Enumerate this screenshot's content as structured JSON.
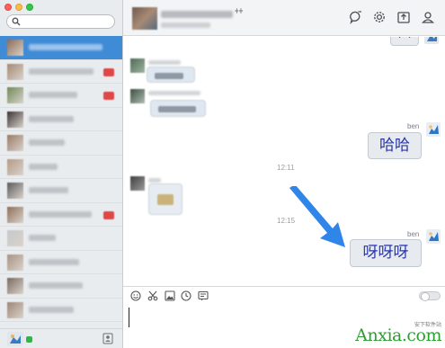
{
  "sidebar": {
    "search": {
      "placeholder": ""
    },
    "conversations": [
      {
        "active": true,
        "avatar": "#8d6b55",
        "name_w": 82,
        "badge": false
      },
      {
        "active": false,
        "avatar": "#a58a73",
        "name_w": 72,
        "badge": true
      },
      {
        "active": false,
        "avatar": "#6f8a56",
        "name_w": 54,
        "badge": true
      },
      {
        "active": false,
        "avatar": "#3a3332",
        "name_w": 50,
        "badge": false
      },
      {
        "active": false,
        "avatar": "#9a7b66",
        "name_w": 40,
        "badge": false
      },
      {
        "active": false,
        "avatar": "#b59a84",
        "name_w": 32,
        "badge": false
      },
      {
        "active": false,
        "avatar": "#5b5b5b",
        "name_w": 44,
        "badge": false
      },
      {
        "active": false,
        "avatar": "#8f6f58",
        "name_w": 70,
        "badge": true
      },
      {
        "active": false,
        "avatar": "#c7c9cc",
        "name_w": 30,
        "badge": false
      },
      {
        "active": false,
        "avatar": "#a89383",
        "name_w": 56,
        "badge": false
      },
      {
        "active": false,
        "avatar": "#7a6a5e",
        "name_w": 60,
        "badge": false
      },
      {
        "active": false,
        "avatar": "#9f8577",
        "name_w": 50,
        "badge": false
      }
    ]
  },
  "header": {
    "mark": "ǂǂ",
    "icons": [
      "chat-bubble-icon",
      "gear-icon",
      "share-icon",
      "person-icon"
    ]
  },
  "messages": {
    "top_partial_char": "穴",
    "msg1": {
      "sender": "ben",
      "text": "哈哈"
    },
    "time1": "12:11",
    "time2": "12:15",
    "msg2": {
      "sender": "ben",
      "text": "呀呀呀"
    }
  },
  "toolbar": {
    "icons": [
      "emoji-icon",
      "scissors-icon",
      "image-icon",
      "clock-icon",
      "history-icon"
    ]
  },
  "watermark": {
    "text": "Anxia.com",
    "subtext": "安下软件站"
  },
  "colors": {
    "accent": "#3f8bd6",
    "bubble_text": "#2a36a8",
    "arrow": "#2f86e8",
    "watermark": "#2e9e34"
  }
}
